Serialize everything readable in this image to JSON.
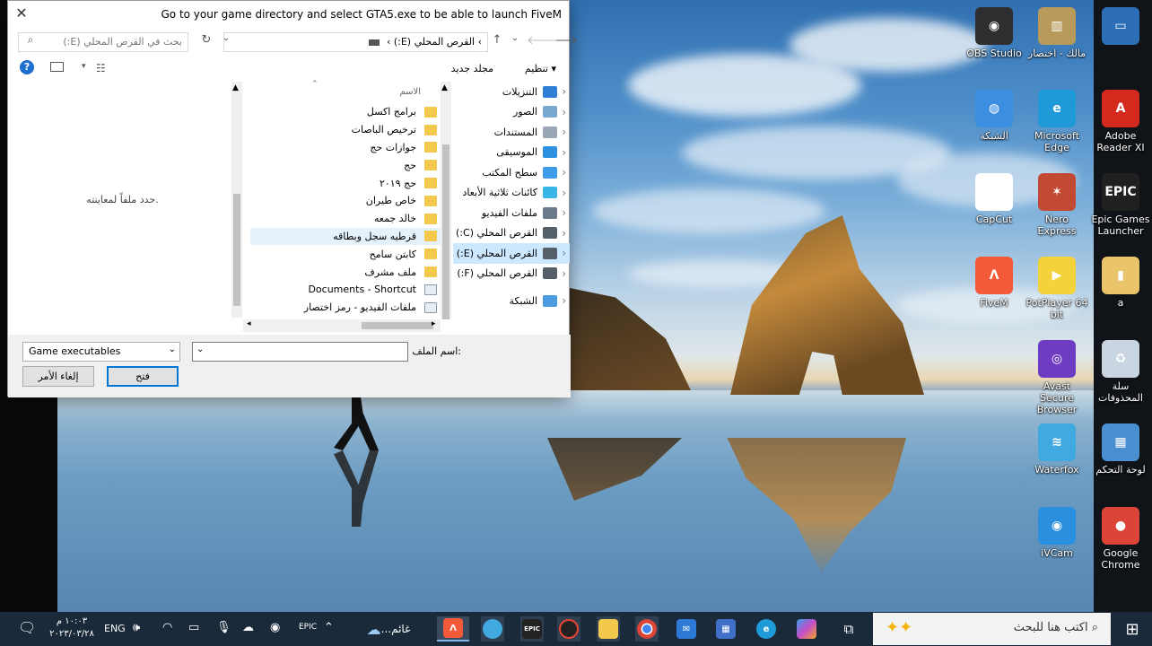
{
  "dialog": {
    "title": "Go to your game directory and select GTA5.exe to be able to launch FiveM",
    "close_glyph": "✕",
    "address_path": "›  القرص المحلي (E:)  ›",
    "search_placeholder": "بحث في القرص المحلي (E:)",
    "toolbar": {
      "organize": "تنظيم",
      "new_folder": "مجلد جديد"
    },
    "nav_items": [
      {
        "label": "التنزيلات",
        "color": "#2f7fd6"
      },
      {
        "label": "الصور",
        "color": "#7aa7cf"
      },
      {
        "label": "المستندات",
        "color": "#9aa7b4"
      },
      {
        "label": "الموسيقى",
        "color": "#2d8fe0"
      },
      {
        "label": "سطح المكتب",
        "color": "#3e9be9"
      },
      {
        "label": "كائنات ثلاثية الأبعاد",
        "color": "#38b6e8"
      },
      {
        "label": "ملفات الفيديو",
        "color": "#6b7a8a"
      },
      {
        "label": "القرص المحلي (C:)",
        "color": "#555f6a"
      },
      {
        "label": "القرص المحلي (E:)",
        "color": "#555f6a"
      },
      {
        "label": "القرص المحلي (F:)",
        "color": "#555f6a"
      },
      {
        "label": "الشبكة",
        "color": "#4a9be0"
      }
    ],
    "column_header": "الاسم",
    "files": [
      {
        "name": "برامج اكسل",
        "link": false
      },
      {
        "name": "ترخيص الباصات",
        "link": false
      },
      {
        "name": "جوازات حج",
        "link": false
      },
      {
        "name": "حج",
        "link": false
      },
      {
        "name": "حج ٢٠١٩",
        "link": false
      },
      {
        "name": "خاص طيران",
        "link": false
      },
      {
        "name": "خالد جمعه",
        "link": false
      },
      {
        "name": "قرطيه سجل وبطاقه",
        "link": false
      },
      {
        "name": "كابتن سامح",
        "link": false
      },
      {
        "name": "ملف مشرف",
        "link": false
      },
      {
        "name": "Documents - Shortcut",
        "link": true
      },
      {
        "name": "ملفات الفيديو - رمز اختصار",
        "link": true
      }
    ],
    "preview_text": "حدد ملفاً لمعاينته.",
    "filename_label": "اسم الملف:",
    "filename_value": "",
    "filetype_value": "Game executables",
    "open_button": "فتح",
    "cancel_button": "إلغاء الأمر"
  },
  "desktop_icons": [
    {
      "label": "OBS Studio",
      "color": "#302e31",
      "glyph": "◉"
    },
    {
      "label": "مالك - اختصار",
      "color": "#b89a5a",
      "glyph": "▥"
    },
    {
      "label": "",
      "color": "#2d6fb7",
      "glyph": "▭"
    },
    {
      "label": "الشبكة",
      "color": "#3c8fe0",
      "glyph": "◍"
    },
    {
      "label": "Microsoft Edge",
      "color": "#1f9ad9",
      "glyph": "e"
    },
    {
      "label": "Adobe Reader XI",
      "color": "#d42a1e",
      "glyph": "A"
    },
    {
      "label": "CapCut",
      "color": "#ffffff",
      "glyph": "✂"
    },
    {
      "label": "Nero Express",
      "color": "#c24a33",
      "glyph": "✶"
    },
    {
      "label": "Epic Games Launcher",
      "color": "#202020",
      "glyph": "EPIC"
    },
    {
      "label": "FiveM",
      "color": "#f25a3a",
      "glyph": "Λ"
    },
    {
      "label": "PotPlayer 64 bit",
      "color": "#f3d23b",
      "glyph": "▶"
    },
    {
      "label": "a",
      "color": "#e9c46a",
      "glyph": "▮"
    },
    {
      "label": "Avast Secure Browser",
      "color": "#6d3cc2",
      "glyph": "◎"
    },
    {
      "label": "سلة المحذوفات",
      "color": "#c9d6e2",
      "glyph": "♻"
    },
    {
      "label": "Waterfox",
      "color": "#3fa9e0",
      "glyph": "≋"
    },
    {
      "label": "لوحة التحكم",
      "color": "#4a8fd0",
      "glyph": "▦"
    },
    {
      "label": "iVCam",
      "color": "#2b8fe0",
      "glyph": "◉"
    },
    {
      "label": "Google Chrome",
      "color": "#db4437",
      "glyph": "●"
    }
  ],
  "taskbar": {
    "search_placeholder": "اكتب هنا للبحث",
    "weather": "غائم...",
    "language": "ENG",
    "time": "١٠:٠٣ م",
    "date": "٢٠٢٣/٠٣/٢٨"
  }
}
